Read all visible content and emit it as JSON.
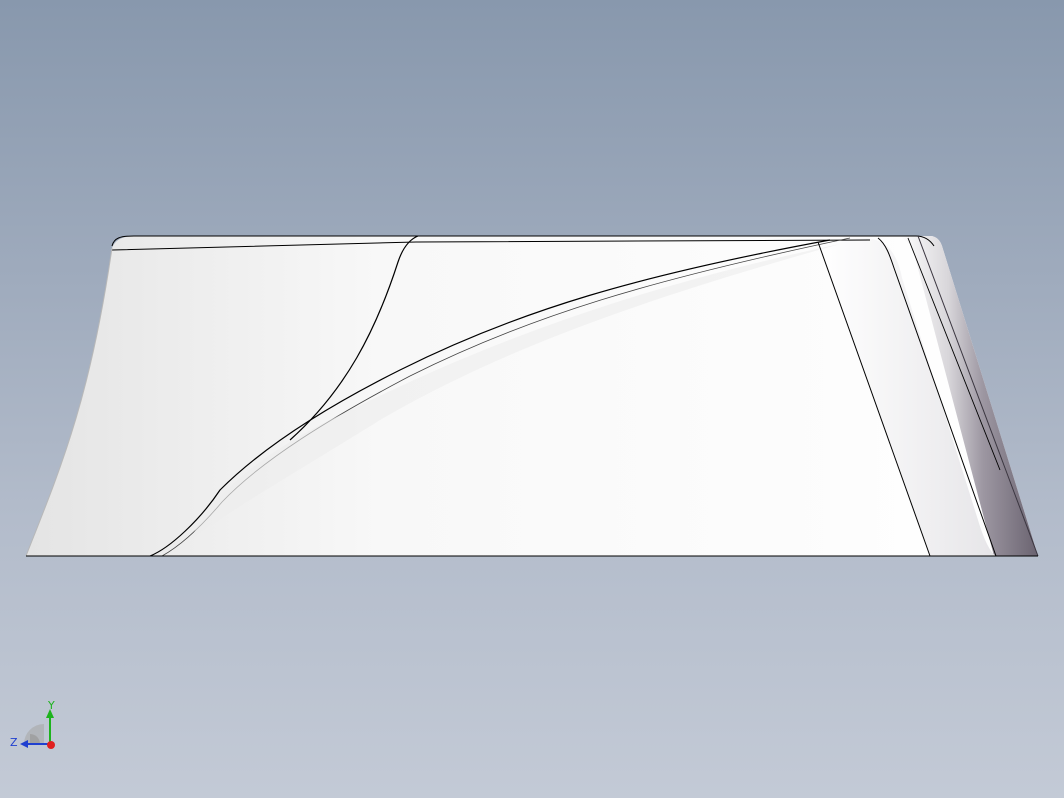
{
  "viewport": {
    "background_top": "#8898ad",
    "background_bottom": "#c3cad6"
  },
  "model": {
    "name": "swept-solid-part",
    "face_color": "#ffffff",
    "shadow_color": "#6e6674",
    "edge_color": "#000000"
  },
  "triad": {
    "y_label": "Y",
    "z_label": "Z",
    "y_color": "#1db31d",
    "x_color": "#e02020",
    "z_color": "#2040d0"
  }
}
